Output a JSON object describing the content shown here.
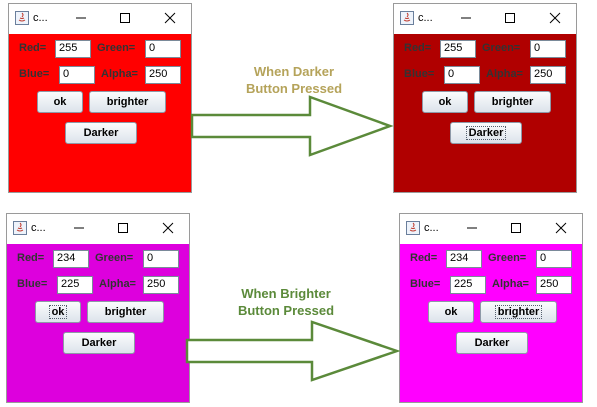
{
  "windows": [
    {
      "title": "c...",
      "bg": "#ff0000",
      "red_label": "Red=",
      "red": "255",
      "green_label": "Green=",
      "green": "0",
      "blue_label": "Blue=",
      "blue": "0",
      "alpha_label": "Alpha=",
      "alpha": "250",
      "ok_label": "ok",
      "brighter_label": "brighter",
      "darker_label": "Darker"
    },
    {
      "title": "c...",
      "bg": "#b00000",
      "red_label": "Red=",
      "red": "255",
      "green_label": "Green=",
      "green": "0",
      "blue_label": "Blue=",
      "blue": "0",
      "alpha_label": "Alpha=",
      "alpha": "250",
      "ok_label": "ok",
      "brighter_label": "brighter",
      "darker_label": "Darker"
    },
    {
      "title": "c...",
      "bg": "#dd00dd",
      "red_label": "Red=",
      "red": "234",
      "green_label": "Green=",
      "green": "0",
      "blue_label": "Blue=",
      "blue": "225",
      "alpha_label": "Alpha=",
      "alpha": "250",
      "ok_label": "ok",
      "brighter_label": "brighter",
      "darker_label": "Darker"
    },
    {
      "title": "c...",
      "bg": "#ff00ff",
      "red_label": "Red=",
      "red": "234",
      "green_label": "Green=",
      "green": "0",
      "blue_label": "Blue=",
      "blue": "225",
      "alpha_label": "Alpha=",
      "alpha": "250",
      "ok_label": "ok",
      "brighter_label": "brighter",
      "darker_label": "Darker"
    }
  ],
  "captions": {
    "darker_line1": "When Darker",
    "darker_line2": "Button Pressed",
    "darker_color": "#b5a35a",
    "brighter_line1": "When Brighter",
    "brighter_line2": "Button Pressed",
    "brighter_color": "#5b8a3a"
  },
  "arrow_color": "#5b8a3a"
}
